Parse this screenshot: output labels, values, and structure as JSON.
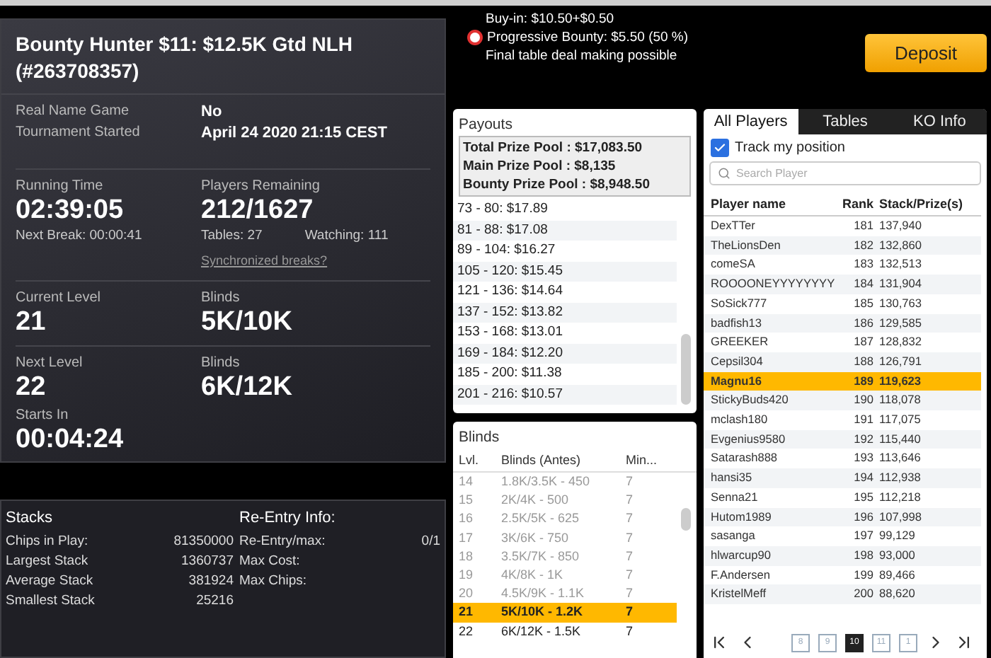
{
  "tournament": {
    "title": "Bounty Hunter $11: $12.5K Gtd NLH (#263708357)",
    "info": [
      {
        "label": "Real Name Game",
        "value": "No"
      },
      {
        "label": "Tournament Started",
        "value": "April 24 2020 21:15 CEST"
      }
    ],
    "running_time": {
      "label": "Running Time",
      "value": "02:39:05",
      "next_break": "Next Break: 00:00:41"
    },
    "players_remaining": {
      "label": "Players Remaining",
      "value": "212/1627",
      "tables": "Tables: 27",
      "watching": "Watching: 111",
      "sync_link": "Synchronized breaks?"
    },
    "current_level": {
      "label": "Current Level",
      "value": "21",
      "blinds_label": "Blinds",
      "blinds": "5K/10K"
    },
    "next_level": {
      "label": "Next Level",
      "value": "22",
      "blinds_label": "Blinds",
      "blinds": "6K/12K",
      "starts_label": "Starts In",
      "starts": "00:04:24"
    }
  },
  "stacks": {
    "title": "Stacks",
    "rows": [
      {
        "label": "Chips in Play:",
        "value": "81350000"
      },
      {
        "label": "Largest Stack",
        "value": "1360737"
      },
      {
        "label": "Average Stack",
        "value": "381924"
      },
      {
        "label": "Smallest Stack",
        "value": "25216"
      }
    ]
  },
  "reentry": {
    "title": "Re-Entry Info:",
    "rows": [
      {
        "label": "Re-Entry/max:",
        "value": "0/1"
      },
      {
        "label": "Max Cost:"
      },
      {
        "label": "Max Chips:"
      }
    ]
  },
  "header_info": {
    "lines": [
      {
        "text": "Buy-in: $10.50+$0.50",
        "bounty": false
      },
      {
        "text": "Progressive Bounty: $5.50 (50 %)",
        "bounty": true
      },
      {
        "text": "Final table deal making possible",
        "bounty": false
      }
    ],
    "deposit": "Deposit"
  },
  "payouts": {
    "title": "Payouts",
    "pools": [
      "Total Prize Pool : $17,083.50",
      "Main Prize Pool : $8,135",
      "Bounty Prize Pool : $8,948.50"
    ],
    "rows": [
      "73 - 80: $17.89",
      "81 - 88: $17.08",
      "89 - 104: $16.27",
      "105 - 120: $15.45",
      "121 - 136: $14.64",
      "137 - 152: $13.82",
      "153 - 168: $13.01",
      "169 - 184: $12.20",
      "185 - 200: $11.38",
      "201 - 216: $10.57"
    ]
  },
  "blinds": {
    "title": "Blinds",
    "columns": [
      "Lvl.",
      "Blinds (Antes)",
      "Min..."
    ],
    "rows": [
      {
        "level": "14",
        "blinds": "1.8K/3.5K - 450",
        "min": "7",
        "past": true,
        "current": false
      },
      {
        "level": "15",
        "blinds": "2K/4K - 500",
        "min": "7",
        "past": true,
        "current": false
      },
      {
        "level": "16",
        "blinds": "2.5K/5K - 625",
        "min": "7",
        "past": true,
        "current": false
      },
      {
        "level": "17",
        "blinds": "3K/6K - 750",
        "min": "7",
        "past": true,
        "current": false
      },
      {
        "level": "18",
        "blinds": "3.5K/7K - 850",
        "min": "7",
        "past": true,
        "current": false
      },
      {
        "level": "19",
        "blinds": "4K/8K - 1K",
        "min": "7",
        "past": true,
        "current": false
      },
      {
        "level": "20",
        "blinds": "4.5K/9K - 1.1K",
        "min": "7",
        "past": true,
        "current": false
      },
      {
        "level": "21",
        "blinds": "5K/10K - 1.2K",
        "min": "7",
        "past": false,
        "current": true
      },
      {
        "level": "22",
        "blinds": "6K/12K - 1.5K",
        "min": "7",
        "past": false,
        "current": false
      }
    ]
  },
  "players": {
    "tabs": [
      {
        "label": "All Players",
        "selected": true
      },
      {
        "label": "Tables",
        "selected": false
      },
      {
        "label": "KO Info",
        "selected": false
      }
    ],
    "track": {
      "label": "Track my position",
      "checked": true
    },
    "search": {
      "placeholder": "Search Player"
    },
    "columns": [
      "Player name",
      "Rank",
      "Stack/Prize(s)"
    ],
    "rows": [
      {
        "name": "DexTTer",
        "rank": "181",
        "stack": "137,940",
        "selected": false
      },
      {
        "name": "TheLionsDen",
        "rank": "182",
        "stack": "132,860",
        "selected": false
      },
      {
        "name": "comeSA",
        "rank": "183",
        "stack": "132,513",
        "selected": false
      },
      {
        "name": "ROOOONEYYYYYYYY",
        "rank": "184",
        "stack": "131,904",
        "selected": false
      },
      {
        "name": "SoSick777",
        "rank": "185",
        "stack": "130,763",
        "selected": false
      },
      {
        "name": "badfish13",
        "rank": "186",
        "stack": "129,585",
        "selected": false
      },
      {
        "name": "GREEKER",
        "rank": "187",
        "stack": "128,832",
        "selected": false
      },
      {
        "name": "Cepsil304",
        "rank": "188",
        "stack": "126,791",
        "selected": false
      },
      {
        "name": "Magnu16",
        "rank": "189",
        "stack": "119,623",
        "selected": true
      },
      {
        "name": "StickyBuds420",
        "rank": "190",
        "stack": "118,078",
        "selected": false
      },
      {
        "name": "mclash180",
        "rank": "191",
        "stack": "117,075",
        "selected": false
      },
      {
        "name": "Evgenius9580",
        "rank": "192",
        "stack": "115,440",
        "selected": false
      },
      {
        "name": "Satarash888",
        "rank": "193",
        "stack": "113,646",
        "selected": false
      },
      {
        "name": "hansi35",
        "rank": "194",
        "stack": "112,938",
        "selected": false
      },
      {
        "name": "Senna21",
        "rank": "195",
        "stack": "112,218",
        "selected": false
      },
      {
        "name": "Hutom1989",
        "rank": "196",
        "stack": "107,998",
        "selected": false
      },
      {
        "name": "sasanga",
        "rank": "197",
        "stack": "99,129",
        "selected": false
      },
      {
        "name": "hlwarcup90",
        "rank": "198",
        "stack": "93,000",
        "selected": false
      },
      {
        "name": "F.Andersen",
        "rank": "199",
        "stack": "89,466",
        "selected": false
      },
      {
        "name": "KristelMeff",
        "rank": "200",
        "stack": "88,620",
        "selected": false
      }
    ],
    "pages": [
      {
        "label": "8",
        "selected": false
      },
      {
        "label": "9",
        "selected": false
      },
      {
        "label": "10",
        "selected": true
      },
      {
        "label": "11",
        "selected": false
      },
      {
        "label": "1",
        "selected": false
      }
    ]
  }
}
